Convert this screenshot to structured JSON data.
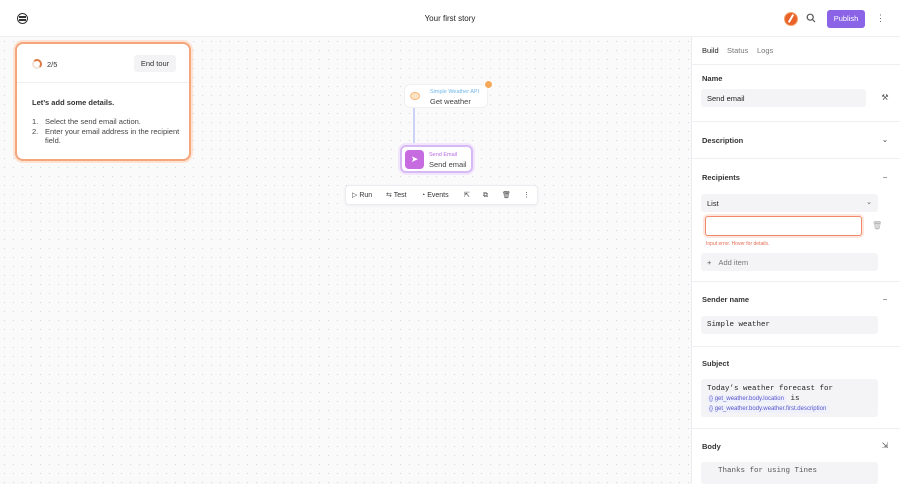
{
  "header": {
    "story_title": "Your first story",
    "publish_label": "Publish"
  },
  "tour": {
    "progress": "2/5",
    "end_label": "End tour",
    "heading": "Let’s add some details.",
    "steps": [
      {
        "num": "1.",
        "text": "Select the send email action."
      },
      {
        "num": "2.",
        "text": "Enter your email address in the recipient field."
      }
    ]
  },
  "nodes": [
    {
      "subtitle": "Simple Weather API",
      "title": "Get weather"
    },
    {
      "subtitle": "Send Email",
      "title": "Send email"
    }
  ],
  "action_bar": {
    "run": "Run",
    "test": "Test",
    "events": "Events"
  },
  "panel": {
    "tabs": [
      "Build",
      "Status",
      "Logs"
    ],
    "name_label": "Name",
    "name_value": "Send email",
    "description_label": "Description",
    "recipients_label": "Recipients",
    "recipients_mode": "List",
    "input_error": "Input error. Hover for details.",
    "add_item": "Add item",
    "sender_label": "Sender name",
    "sender_value": "Simple weather",
    "subject_label": "Subject",
    "subject_text1": "Today’s weather forecast for",
    "subject_token1": "get_weather.body.location",
    "subject_text2": "is",
    "subject_token2": "get_weather.body.weather.first.description",
    "body_label": "Body",
    "body_preview": "Thanks for using Tines"
  },
  "colors": {
    "accent": "#8a63e6",
    "tour_border": "#f4a57c",
    "error": "#e26b50"
  }
}
